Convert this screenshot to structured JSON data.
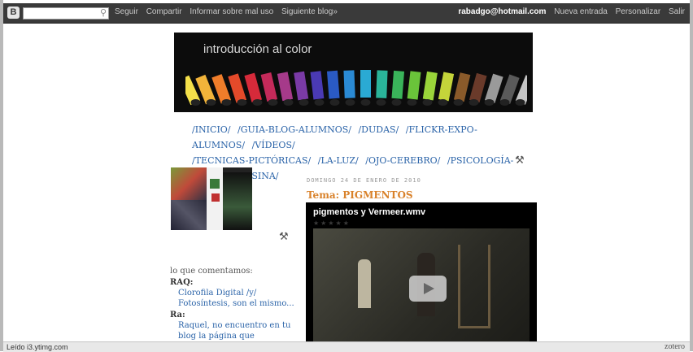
{
  "navbar": {
    "logo": "B",
    "search_placeholder": "",
    "links": [
      "Seguir",
      "Compartir",
      "Informar sobre mal uso",
      "Siguiente blog»"
    ],
    "user_email": "rabadgo@hotmail.com",
    "right_links": [
      "Nueva entrada",
      "Personalizar",
      "Salir"
    ]
  },
  "header": {
    "title": "introducción al color"
  },
  "tabs": {
    "row1": [
      "/INICIO/",
      "/GUIA-BLOG-ALUMNOS/",
      "/DUDAS/",
      "/FLICKR-EXPO-ALUMNOS/",
      "/VÍDEOS/"
    ],
    "row2": [
      "/TECNICAS-PICTÓRICAS/",
      "/LA-LUZ/",
      "/OJO-CEREBRO/",
      "/PSICOLOGÍA-COLOR/",
      "/TESINA/"
    ]
  },
  "widget": {
    "heading": "lo que comentamos:",
    "comments": [
      {
        "author": "RAQ:",
        "text": "Clorofila Digital /y/ Fotosíntesis, son el mismo..."
      },
      {
        "author": "Ra:",
        "text": "Raquel, no encuentro en tu blog la página que nombraste el..."
      }
    ]
  },
  "post": {
    "date": "DOMINGO 24 DE ENERO DE 2010",
    "title": "Tema: PIGMENTOS",
    "video_title": "pigmentos y Vermeer.wmv",
    "video_stars": "★★★★★"
  },
  "status": {
    "text": "Leído i3.ytimg.com",
    "addon": "zotero"
  },
  "colors": {
    "navbar": "#3a3a3a",
    "link": "#2a63a8",
    "post_title": "#d9822b"
  },
  "icons": [
    "blogger-logo-icon",
    "search-icon",
    "wrench-screwdriver-icon",
    "play-icon"
  ]
}
